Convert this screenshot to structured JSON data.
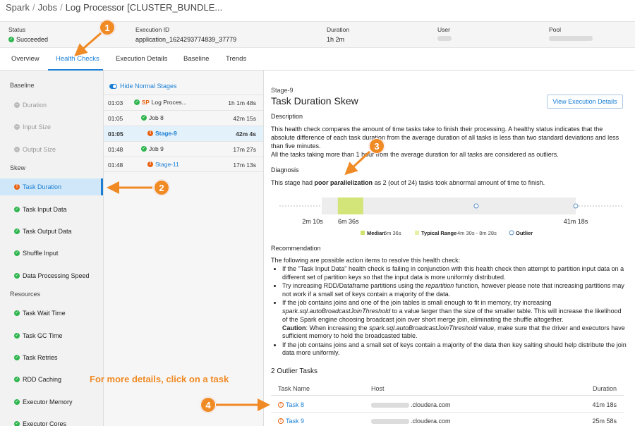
{
  "breadcrumb": [
    "Spark",
    "Jobs",
    "Log Processor [CLUSTER_BUNDLE..."
  ],
  "summary": {
    "status_label": "Status",
    "status_value": "Succeeded",
    "execution_id_label": "Execution ID",
    "execution_id_value": "application_1624293774839_37779",
    "duration_label": "Duration",
    "duration_value": "1h 2m",
    "user_label": "User",
    "pool_label": "Pool"
  },
  "tabs": [
    "Overview",
    "Health Checks",
    "Execution Details",
    "Baseline",
    "Trends"
  ],
  "sidebar": {
    "groups": [
      "Baseline",
      "Skew",
      "Resources"
    ],
    "baseline_items": [
      "Duration",
      "Input Size",
      "Output Size"
    ],
    "skew_items": [
      "Task Duration",
      "Task Input Data",
      "Task Output Data",
      "Shuffle Input",
      "Data Processing Speed"
    ],
    "resource_items": [
      "Task Wait Time",
      "Task GC Time",
      "Task Retries",
      "RDD Caching",
      "Executor Memory",
      "Executor Cores"
    ]
  },
  "stages": {
    "hide_label": "Hide Normal Stages",
    "rows": [
      {
        "time": "01:03",
        "badge": "SP",
        "name": "Log Proces...",
        "duration": "1h 1m 48s"
      },
      {
        "time": "01:05",
        "name": "Job 8",
        "duration": "42m 15s"
      },
      {
        "time": "01:05",
        "name": "Stage-9",
        "duration": "42m 4s"
      },
      {
        "time": "01:48",
        "name": "Job 9",
        "duration": "17m 27s"
      },
      {
        "time": "01:48",
        "name": "Stage-11",
        "duration": "17m 13s"
      }
    ]
  },
  "main": {
    "stage_id": "Stage-9",
    "title": "Task Duration Skew",
    "view_button": "View Execution Details",
    "description_heading": "Description",
    "description_text": "This health check compares the amount of time tasks take to finish their processing. A healthy status indicates that the absolute difference of each task duration from the average duration of all tasks is less than two standard deviations and less than five minutes.",
    "description_text2": "All the tasks taking more than 1 hour from the average duration for all tasks are considered as outliers.",
    "diagnosis_heading": "Diagnosis",
    "diagnosis_prefix": "This stage had ",
    "diagnosis_bold": "poor parallelization",
    "diagnosis_suffix": " as 2 (out of 24) tasks took abnormal amount of time to finish.",
    "recommendation_heading": "Recommendation",
    "recommendation_intro": "The following are possible action items to resolve this health check:",
    "rec1": "If the \"Task Input Data\" health check is failing in conjunction with this health check then attempt to partition input data on a different set of partition keys so that the input data is more uniformly distributed.",
    "rec2_a": "Try increasing RDD/Dataframe partitions using the ",
    "rec2_i": "repartition",
    "rec2_b": " function, however please note that increasing partitions may not work if a small set of keys contain a majority of the data.",
    "rec3_a": "If the job contains joins and one of the join tables is small enough to fit in memory, try increasing ",
    "rec3_i": "spark.sql.autoBroadcastJoinThreshold",
    "rec3_b": " to a value larger than the size of the smaller table. This will increase the likelihood of the Spark engine choosing broadcast join over short merge join, eliminating the shuffle altogether.",
    "rec3_caution": "Caution",
    "rec3_c": ": When increasing the ",
    "rec3_i2": "spark.sql.autoBroadcastJoinThreshold",
    "rec3_d": " value, make sure that the driver and executors have sufficient memory to hold the broadcasted table.",
    "rec4": "If the job contains joins and a small set of keys contain a majority of the data then key salting should help distribute the join data more uniformly.",
    "outliers_heading": "2 Outlier Tasks",
    "outliers_columns": [
      "Task Name",
      "Host",
      "Duration"
    ],
    "outliers": [
      {
        "task": "Task 8",
        "host_suffix": ".cloudera.com",
        "duration": "41m 18s"
      },
      {
        "task": "Task 9",
        "host_suffix": ".cloudera.com",
        "duration": "25m 58s"
      }
    ]
  },
  "chart_data": {
    "type": "scatter",
    "x_unit": "seconds",
    "range": [
      612,
      2478
    ],
    "tick_labels": [
      "2m 10s",
      "6m 36s",
      "41m 18s"
    ],
    "median": 396,
    "typical_range": [
      270,
      508
    ],
    "outliers": [
      1558,
      2478
    ],
    "legend": {
      "median_label": "Median",
      "median_value": "6m 36s",
      "typical_label": "Typical Range",
      "typical_value": "4m 30s - 8m 28s",
      "outlier_label": "Outlier"
    }
  },
  "annotations": {
    "hint": "For more details, click on a task",
    "callouts": [
      "1",
      "2",
      "3",
      "4"
    ]
  },
  "colors": {
    "accent": "#1a7fd4",
    "success": "#2fb64f",
    "warning": "#e8600f",
    "callout": "#f08a24",
    "median": "#cfe36a",
    "typical": "#eef2b8"
  }
}
